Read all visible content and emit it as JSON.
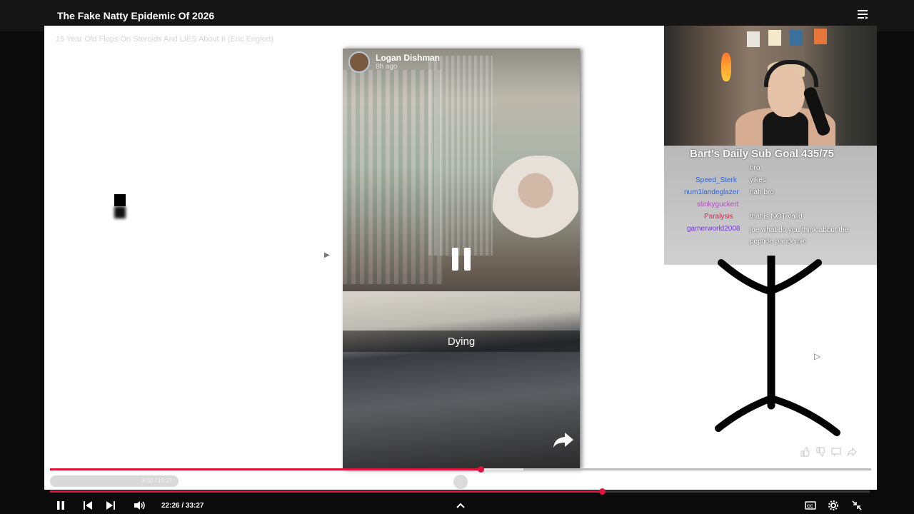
{
  "video": {
    "title": "The Fake Natty Epidemic Of 2026",
    "inner_title": "15 Year Old Flops On Steroids And LIES About It (Eric Englert)",
    "inner_time": "8:02 / 15:27",
    "time": "22:26 / 33:27",
    "progress_fraction": 0.673,
    "inner_progress_fraction": 0.524
  },
  "story": {
    "name": "Logan Dishman",
    "time_ago": "8h ago",
    "caption": "Dying"
  },
  "overlay": {
    "sub_goal": "Bart's Daily Sub Goal 435/75",
    "chat": [
      {
        "user": "",
        "message": "bro",
        "color": "#2a5a8a"
      },
      {
        "user": "Speed_Sterk",
        "message": "yikes",
        "color": "#1e5bdb"
      },
      {
        "user": "num1landeglazer",
        "message": "nah bro",
        "color": "#1e5bdb"
      },
      {
        "user": "stinkyguckert",
        "message": "",
        "color": "#b146c2"
      },
      {
        "user": "Paralysis",
        "message": "that is NOT valid",
        "color": "#e0143c"
      },
      {
        "user": "gamerworld2008",
        "message": "joe what do you think about the peptide pandemic",
        "color": "#6a2bd8"
      }
    ]
  },
  "colors": {
    "accent": "#e0143c",
    "topbar": "#151515",
    "background": "#0b0b0b"
  }
}
